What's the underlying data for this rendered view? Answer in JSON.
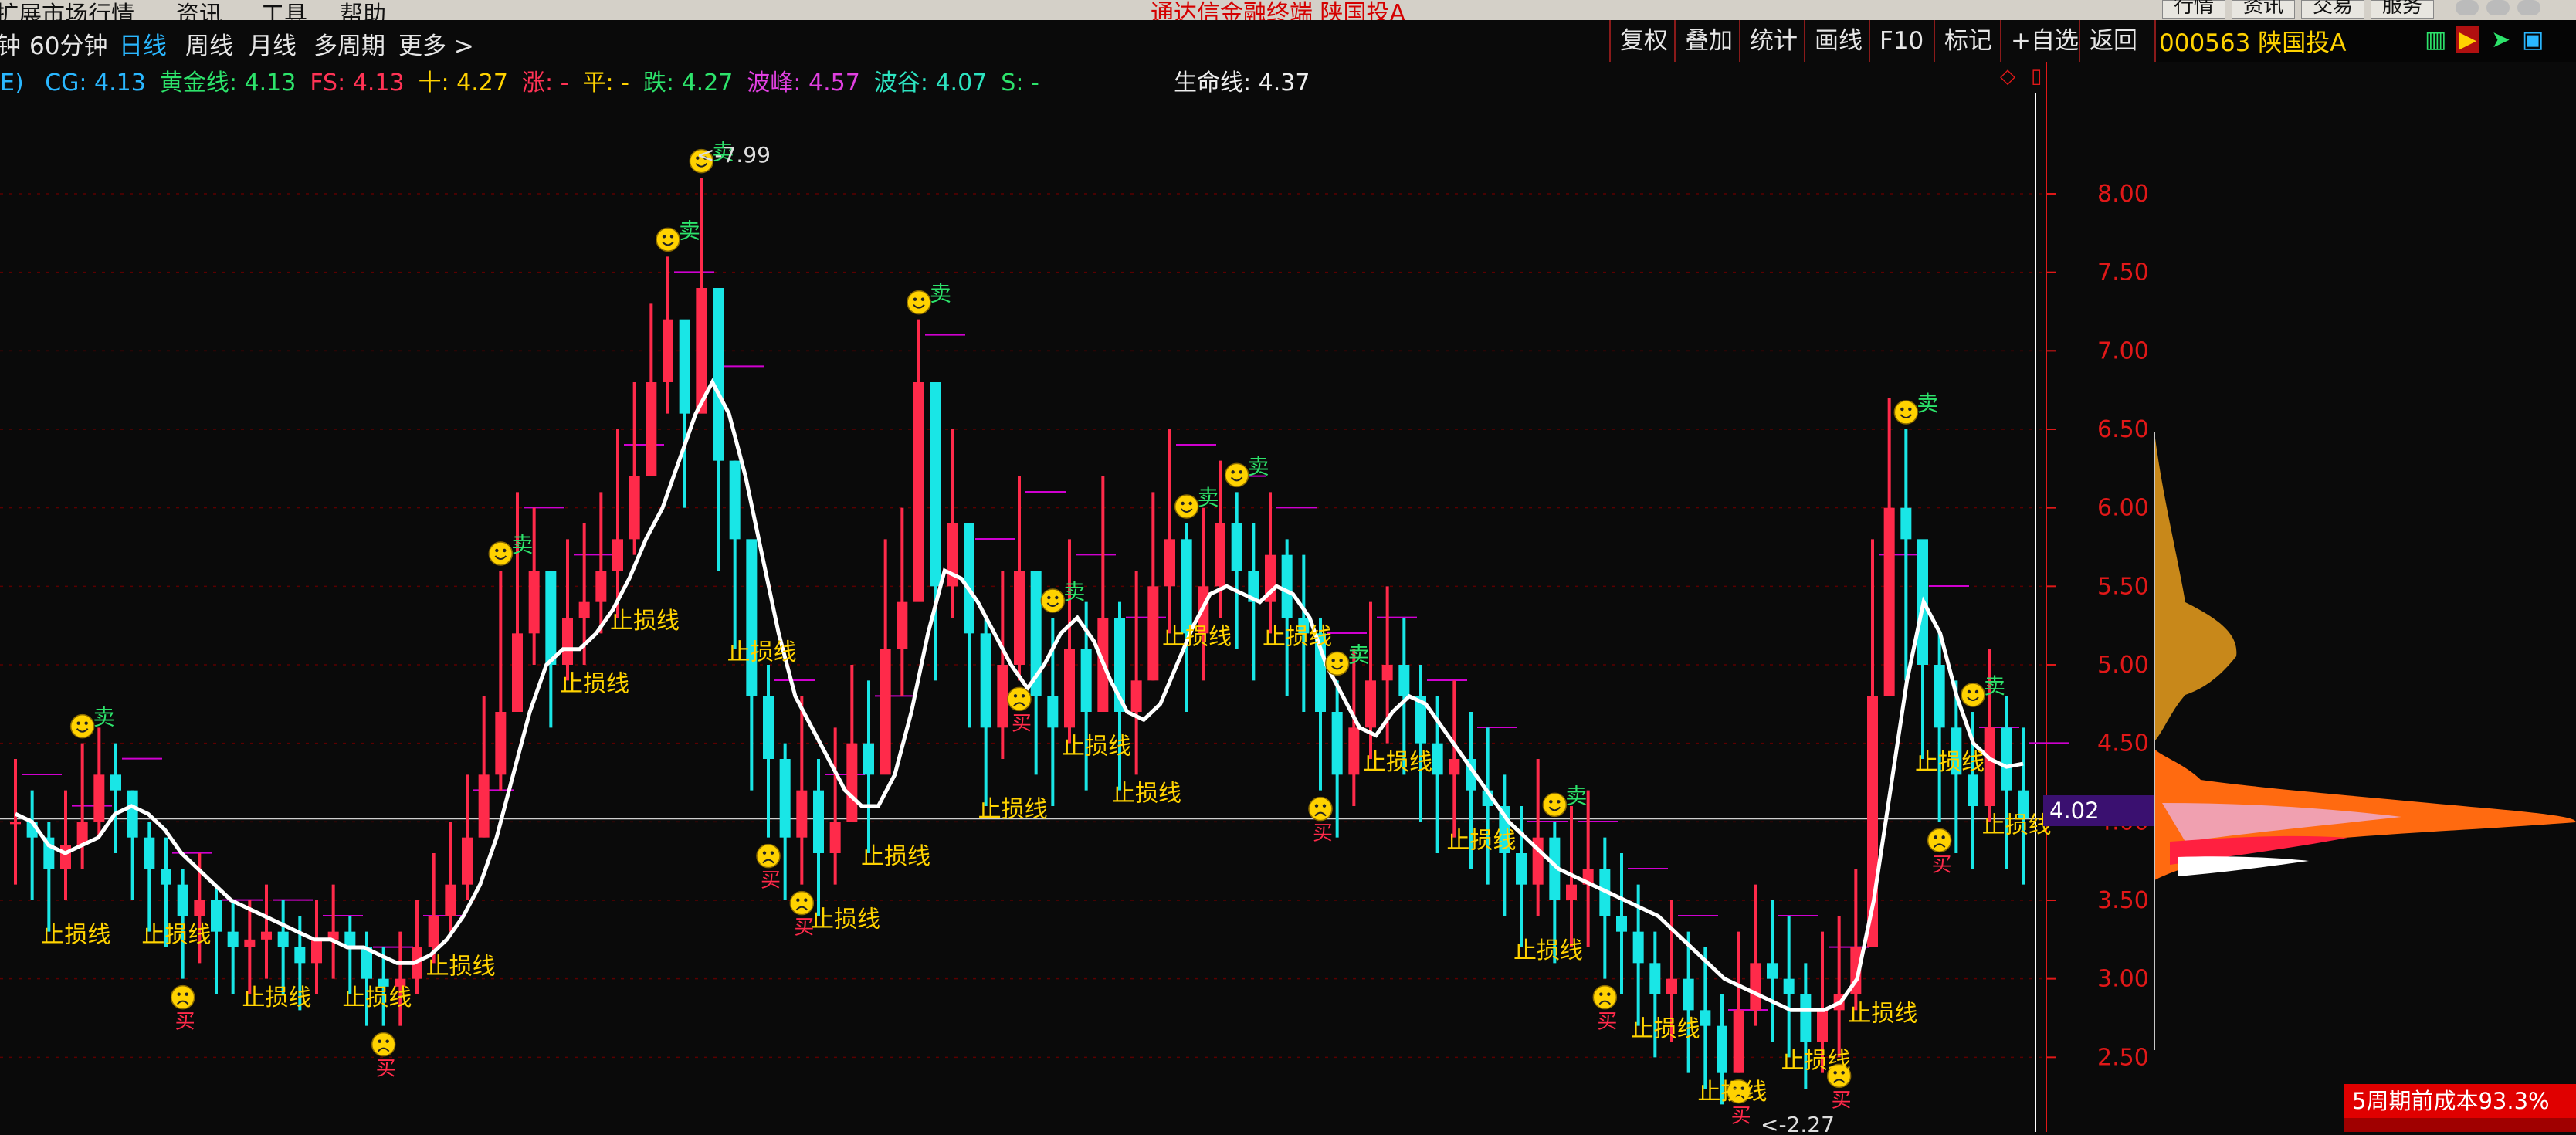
{
  "menubar": {
    "items": [
      "扩展市场行情",
      "资讯",
      "工具",
      "帮助"
    ],
    "title": "通达信金融终端 陕国投A",
    "right_buttons": [
      "行情",
      "资讯",
      "交易",
      "服务"
    ]
  },
  "toolbar": {
    "left": [
      "钟",
      "60分钟",
      "日线",
      "周线",
      "月线",
      "多周期",
      "更多 >"
    ],
    "active": "日线",
    "right": [
      "复权",
      "叠加",
      "统计",
      "画线",
      "F10",
      "标记",
      "+自选",
      "返回"
    ]
  },
  "stock": {
    "code_name": "000563 陕国投A"
  },
  "legend": {
    "prefix": "E)",
    "items": [
      {
        "label": "CG: 4.13",
        "color": "#2ab7ff"
      },
      {
        "label": "黄金线: 4.13",
        "color": "#2de36b"
      },
      {
        "label": "FS: 4.13",
        "color": "#ff3355"
      },
      {
        "label": "十: 4.27",
        "color": "#ffd200"
      },
      {
        "label": "涨: -",
        "color": "#ff3355"
      },
      {
        "label": "平: -",
        "color": "#ffd200"
      },
      {
        "label": "跌: 4.27",
        "color": "#2de36b"
      },
      {
        "label": "波峰: 4.57",
        "color": "#e040e0"
      },
      {
        "label": "波谷: 4.07",
        "color": "#2de3c0"
      },
      {
        "label": "S: -",
        "color": "#2de36b"
      }
    ],
    "lifeline": "生命线: 4.37"
  },
  "labels": {
    "sell": "卖",
    "buy": "买",
    "stop": "止损线",
    "high_mark": "7.99",
    "low_mark": "2.27",
    "last_value": "4.02"
  },
  "badge": "5周期前成本93.3%",
  "colors": {
    "up": "#ff2a4a",
    "down": "#19e6e6",
    "ma": "#ffffff",
    "axis": "#e01818",
    "signal": "#ffd200"
  },
  "chart_data": {
    "type": "line",
    "title": "",
    "ylabel": "",
    "ylim": [
      2.3,
      8.3
    ],
    "y_ticks": [
      "8.00",
      "7.50",
      "7.00",
      "6.50",
      "6.00",
      "5.50",
      "5.00",
      "4.50",
      "4.00",
      "3.50",
      "3.00",
      "2.50"
    ],
    "series": [
      {
        "name": "生命线",
        "values": [
          4.05,
          4.0,
          3.85,
          3.8,
          3.85,
          3.9,
          4.05,
          4.1,
          4.05,
          3.95,
          3.8,
          3.7,
          3.6,
          3.5,
          3.45,
          3.4,
          3.35,
          3.3,
          3.25,
          3.25,
          3.2,
          3.2,
          3.15,
          3.1,
          3.1,
          3.15,
          3.25,
          3.4,
          3.6,
          3.9,
          4.3,
          4.7,
          5.0,
          5.1,
          5.1,
          5.2,
          5.35,
          5.55,
          5.8,
          6.0,
          6.3,
          6.6,
          6.8,
          6.6,
          6.2,
          5.7,
          5.2,
          4.8,
          4.6,
          4.4,
          4.2,
          4.1,
          4.1,
          4.3,
          4.7,
          5.2,
          5.6,
          5.55,
          5.4,
          5.2,
          5.0,
          4.85,
          5.0,
          5.2,
          5.3,
          5.15,
          4.9,
          4.7,
          4.65,
          4.75,
          5.0,
          5.25,
          5.45,
          5.5,
          5.45,
          5.4,
          5.5,
          5.45,
          5.3,
          5.0,
          4.8,
          4.6,
          4.55,
          4.7,
          4.8,
          4.75,
          4.6,
          4.45,
          4.3,
          4.15,
          4.0,
          3.9,
          3.8,
          3.7,
          3.65,
          3.6,
          3.55,
          3.5,
          3.45,
          3.4,
          3.3,
          3.2,
          3.1,
          3.0,
          2.95,
          2.9,
          2.85,
          2.8,
          2.8,
          2.8,
          2.85,
          3.0,
          3.5,
          4.2,
          4.9,
          5.4,
          5.2,
          4.8,
          4.5,
          4.4,
          4.35,
          4.37
        ]
      }
    ],
    "prices": {
      "close": [
        4.0,
        3.9,
        3.7,
        3.85,
        4.0,
        4.3,
        4.2,
        3.9,
        3.7,
        3.6,
        3.4,
        3.5,
        3.3,
        3.2,
        3.25,
        3.3,
        3.2,
        3.1,
        3.25,
        3.3,
        3.2,
        3.0,
        2.95,
        3.0,
        3.2,
        3.4,
        3.6,
        3.9,
        4.3,
        4.7,
        5.2,
        5.6,
        5.0,
        5.3,
        5.4,
        5.6,
        5.8,
        6.2,
        6.8,
        7.2,
        6.6,
        7.4,
        6.3,
        5.8,
        4.8,
        4.4,
        3.9,
        4.2,
        3.8,
        4.0,
        4.5,
        4.3,
        5.1,
        5.4,
        6.8,
        5.5,
        5.9,
        5.2,
        4.6,
        5.0,
        5.6,
        4.8,
        4.6,
        5.1,
        4.7,
        5.3,
        4.7,
        4.9,
        5.5,
        5.8,
        5.2,
        5.5,
        5.9,
        5.6,
        5.4,
        5.7,
        5.3,
        5.2,
        4.7,
        4.3,
        4.6,
        4.9,
        5.0,
        4.8,
        4.5,
        4.3,
        4.4,
        4.2,
        4.1,
        3.8,
        3.6,
        3.9,
        3.5,
        3.6,
        3.7,
        3.4,
        3.3,
        3.1,
        2.9,
        3.0,
        2.8,
        2.7,
        2.4,
        2.8,
        3.1,
        3.0,
        2.9,
        2.6,
        2.8,
        2.9,
        3.2,
        4.8,
        6.0,
        5.8,
        5.0,
        4.6,
        4.3,
        4.1,
        4.6,
        4.2,
        4.02
      ],
      "high": [
        4.4,
        4.2,
        4.0,
        4.2,
        4.5,
        4.6,
        4.5,
        4.2,
        4.0,
        3.9,
        3.7,
        3.8,
        3.6,
        3.5,
        3.5,
        3.6,
        3.5,
        3.4,
        3.5,
        3.6,
        3.4,
        3.3,
        3.2,
        3.3,
        3.5,
        3.8,
        4.0,
        4.3,
        4.8,
        5.6,
        6.1,
        6.0,
        5.5,
        5.8,
        5.9,
        6.1,
        6.5,
        6.8,
        7.3,
        7.6,
        7.1,
        8.1,
        7.0,
        6.3,
        5.4,
        5.0,
        4.5,
        4.8,
        4.4,
        4.6,
        5.0,
        4.9,
        5.8,
        6.0,
        7.2,
        6.2,
        6.5,
        5.9,
        5.3,
        5.6,
        6.2,
        5.4,
        5.3,
        5.8,
        5.4,
        6.2,
        5.4,
        5.6,
        6.1,
        6.5,
        5.9,
        6.0,
        6.3,
        6.1,
        5.9,
        6.1,
        5.8,
        5.7,
        5.3,
        4.9,
        5.1,
        5.4,
        5.5,
        5.3,
        5.0,
        4.8,
        4.9,
        4.7,
        4.6,
        4.3,
        4.1,
        4.4,
        4.0,
        4.1,
        4.2,
        3.9,
        3.8,
        3.6,
        3.3,
        3.5,
        3.3,
        3.2,
        2.9,
        3.3,
        3.6,
        3.5,
        3.4,
        3.1,
        3.3,
        3.4,
        3.7,
        5.8,
        6.7,
        6.5,
        5.6,
        5.2,
        4.9,
        4.7,
        5.1,
        4.8,
        4.6
      ],
      "low": [
        3.6,
        3.5,
        3.3,
        3.5,
        3.7,
        3.9,
        3.8,
        3.5,
        3.3,
        3.2,
        3.0,
        3.1,
        2.9,
        2.9,
        2.9,
        3.0,
        2.9,
        2.8,
        2.9,
        3.0,
        2.9,
        2.7,
        2.7,
        2.7,
        2.9,
        3.1,
        3.3,
        3.5,
        3.9,
        4.2,
        4.7,
        5.0,
        4.6,
        4.9,
        5.0,
        5.2,
        5.3,
        5.7,
        6.2,
        6.6,
        6.0,
        6.8,
        5.6,
        5.1,
        4.2,
        3.9,
        3.5,
        3.6,
        3.4,
        3.6,
        4.0,
        3.8,
        4.5,
        4.8,
        5.9,
        4.9,
        5.3,
        4.6,
        4.1,
        4.4,
        4.9,
        4.3,
        4.1,
        4.5,
        4.2,
        4.7,
        4.2,
        4.3,
        4.9,
        5.2,
        4.7,
        4.9,
        5.3,
        5.1,
        4.9,
        5.2,
        4.8,
        4.7,
        4.2,
        3.9,
        4.1,
        4.4,
        4.5,
        4.3,
        4.0,
        3.8,
        3.9,
        3.7,
        3.6,
        3.4,
        3.2,
        3.4,
        3.1,
        3.2,
        3.2,
        3.0,
        2.9,
        2.7,
        2.5,
        2.6,
        2.4,
        2.3,
        2.2,
        2.4,
        2.7,
        2.6,
        2.5,
        2.3,
        2.4,
        2.5,
        2.8,
        3.6,
        4.9,
        4.9,
        4.4,
        4.0,
        3.8,
        3.7,
        4.0,
        3.7,
        3.6
      ]
    },
    "sell_idx": [
      4,
      29,
      39,
      41,
      54,
      62,
      70,
      73,
      79,
      92,
      113,
      117
    ],
    "buy_idx": [
      10,
      22,
      45,
      47,
      60,
      78,
      95,
      103,
      109,
      115
    ],
    "stop_idx": [
      2,
      8,
      14,
      20,
      25,
      33,
      36,
      43,
      48,
      51,
      58,
      63,
      66,
      69,
      75,
      81,
      86,
      90,
      97,
      101,
      106,
      110,
      114,
      118
    ]
  }
}
